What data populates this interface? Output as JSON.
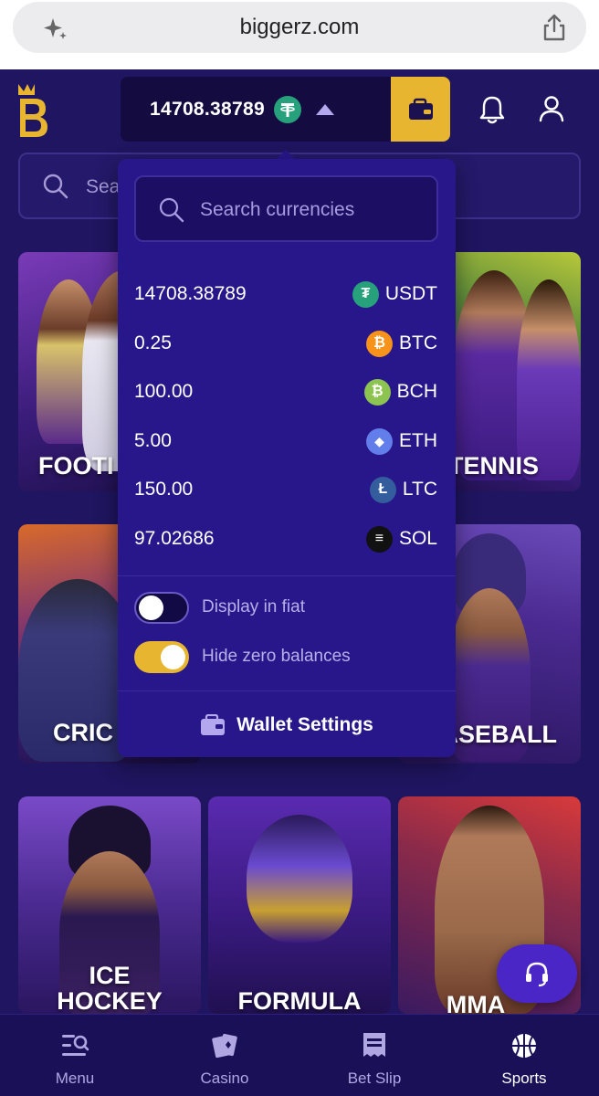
{
  "browser": {
    "url": "biggerz.com"
  },
  "header": {
    "balance": "14708.38789",
    "balance_currency_icon": "usdt-icon"
  },
  "background": {
    "search_placeholder_visible": "Sea",
    "tiles": [
      {
        "label": "FOOTI"
      },
      {
        "label": "TENNIS"
      },
      {
        "label": "CRIC"
      },
      {
        "label": "ASEBALL"
      },
      {
        "label_line1": "ICE",
        "label_line2": "HOCKEY"
      },
      {
        "label": "FORMULA"
      },
      {
        "label": "MMA"
      }
    ]
  },
  "dropdown": {
    "search_placeholder": "Search currencies",
    "currencies": [
      {
        "amount": "14708.38789",
        "code": "USDT",
        "color": "#26a17b",
        "glyph": "₮"
      },
      {
        "amount": "0.25",
        "code": "BTC",
        "color": "#f7931a",
        "glyph": "₿"
      },
      {
        "amount": "100.00",
        "code": "BCH",
        "color": "#8dc351",
        "glyph": "₿"
      },
      {
        "amount": "5.00",
        "code": "ETH",
        "color": "#627eea",
        "glyph": "◆"
      },
      {
        "amount": "150.00",
        "code": "LTC",
        "color": "#345d9d",
        "glyph": "Ł"
      },
      {
        "amount": "97.02686",
        "code": "SOL",
        "color": "#111111",
        "glyph": "≡"
      }
    ],
    "toggles": {
      "display_fiat": {
        "label": "Display in fiat",
        "on": false
      },
      "hide_zero": {
        "label": "Hide zero balances",
        "on": true
      }
    },
    "wallet_settings_label": "Wallet Settings"
  },
  "nav": {
    "items": [
      {
        "label": "Menu"
      },
      {
        "label": "Casino"
      },
      {
        "label": "Bet Slip"
      },
      {
        "label": "Sports"
      }
    ],
    "active": "Sports"
  },
  "colors": {
    "background": "#1f1560",
    "accent_gold": "#e7b530",
    "dropdown": "#28178a"
  }
}
